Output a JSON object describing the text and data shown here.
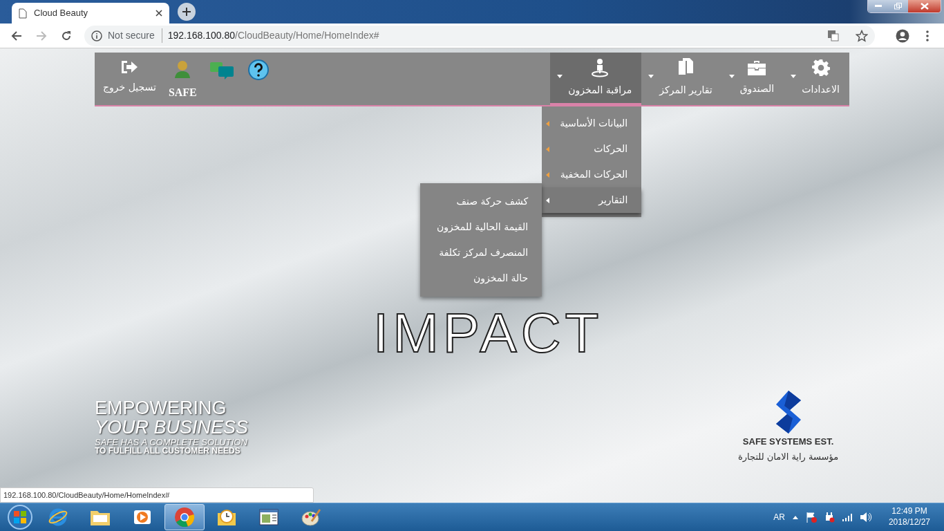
{
  "browser": {
    "tab_title": "Cloud Beauty",
    "security": "Not secure",
    "url_host": "192.168.100.80",
    "url_path": "/CloudBeauty/Home/HomeIndex#"
  },
  "nav": {
    "items": [
      {
        "kind": "gear",
        "label": "الاعدادات",
        "expanded": false
      },
      {
        "kind": "briefcase",
        "label": "الصندوق",
        "expanded": false
      },
      {
        "kind": "copy",
        "label": "تقارير المركز",
        "expanded": false
      },
      {
        "kind": "person",
        "label": "مراقبة المخزون",
        "expanded": true,
        "menu": [
          {
            "label": "البيانات الأساسية",
            "selected": false
          },
          {
            "label": "الحركات",
            "selected": false
          },
          {
            "label": "الحركات المخفية",
            "selected": false
          },
          {
            "label": "التقارير",
            "selected": true,
            "children": [
              {
                "label": "كشف حركة صنف"
              },
              {
                "label": "القيمة الحالية للمخزون"
              },
              {
                "label": "المنصرف لمركز تكلفة"
              },
              {
                "label": "حالة المخزون"
              }
            ]
          }
        ]
      }
    ],
    "user": "SAFE",
    "logout": "تسجيل خروج"
  },
  "logo": "IMPACT",
  "slogan": [
    "EMPOWERING",
    "YOUR BUSINESS",
    "SAFE HAS A COMPLETE SOLUTION",
    "TO FULFILL ALL CUSTOMER NEEDS"
  ],
  "company": {
    "name": "SAFE SYSTEMS EST.",
    "name_ar": "مؤسسة راية الامان للتجارة"
  },
  "status_url": "192.168.100.80/CloudBeauty/Home/HomeIndex#",
  "taskbar": {
    "apps": [
      {
        "kind": "ie",
        "selected": false
      },
      {
        "kind": "folder",
        "selected": false
      },
      {
        "kind": "media",
        "selected": false
      },
      {
        "kind": "chrome",
        "selected": true
      },
      {
        "kind": "mail",
        "selected": false
      },
      {
        "kind": "window",
        "selected": false
      },
      {
        "kind": "paint",
        "selected": false
      }
    ],
    "language": "AR",
    "time": "12:49 PM",
    "date": "2018/12/27"
  }
}
